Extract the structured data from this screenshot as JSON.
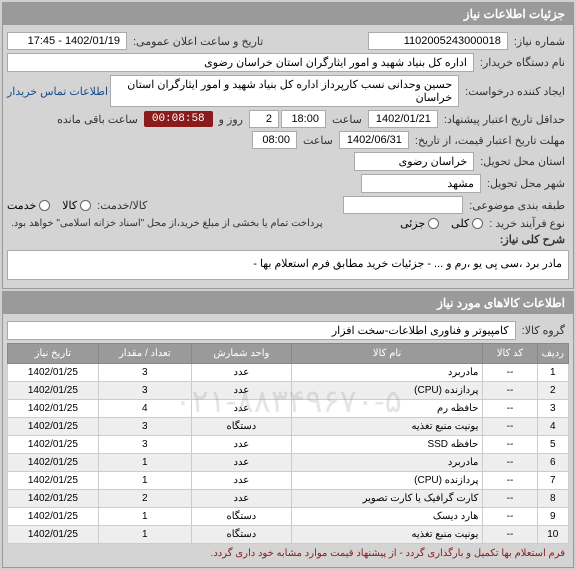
{
  "header": {
    "title": "جزئیات اطلاعات نیاز"
  },
  "fields": {
    "need_no_label": "شماره نیاز:",
    "need_no": "1102005243000018",
    "announce_label": "تاریخ و ساعت اعلان عمومی:",
    "announce": "1402/01/19 - 17:45",
    "buyer_label": "نام دستگاه خریدار:",
    "buyer": "اداره کل بنیاد شهید و امور ایثارگران استان خراسان رضوی",
    "creator_label": "ایجاد کننده درخواست:",
    "creator": "حسین وحدانی نسب کارپرداز اداره کل بنیاد شهید و امور ایثارگران استان خراسان",
    "contact_link": "اطلاعات تماس خریدار",
    "deadline_label": "حداقل تاریخ اعتبار پیشنهاد:",
    "deadline_date": "1402/01/21",
    "deadline_time_label": "ساعت",
    "deadline_time": "18:00",
    "deadline_days_label": "روز و",
    "deadline_days": "2",
    "remaining_label": "ساعت باقی مانده",
    "timer": "00:08:58",
    "validity_label": "مهلت تاریخ اعتبار قیمت، از تاریخ:",
    "validity_date": "1402/06/31",
    "validity_time": "08:00",
    "province_label": "استان محل تحویل:",
    "province": "خراسان رضوی",
    "city_label": "شهر محل تحویل:",
    "city": "مشهد",
    "class_label": "طبقه بندی موضوعی:",
    "service_label": "کالا/خدمت:",
    "opt_service": "خدمت",
    "opt_goods": "کالا",
    "buy_type_label": "نوع فرآیند خرید :",
    "opt_partial": "جزئی",
    "opt_full": "کلی",
    "pay_note": "پرداخت تمام یا بخشی از مبلغ خرید،از محل \"اسناد خزانه اسلامی\" خواهد بود.",
    "desc_label": "شرح کلی نیاز:",
    "desc": "مادر برد ،سی پی یو ،رم و ... - جزئیات خرید مطابق فرم استعلام بها -"
  },
  "section2": {
    "title": "اطلاعات کالاهای مورد نیاز",
    "group_label": "گروه کالا:",
    "group": "کامپیوتر و فناوری اطلاعات-سخت افزار"
  },
  "table": {
    "headers": {
      "row": "ردیف",
      "code": "کد کالا",
      "name": "نام کالا",
      "unit": "واحد شمارش",
      "qty": "تعداد / مقدار",
      "date": "تاریخ نیاز"
    },
    "rows": [
      {
        "r": "1",
        "code": "--",
        "name": "مادربرد",
        "unit": "عدد",
        "qty": "3",
        "date": "1402/01/25"
      },
      {
        "r": "2",
        "code": "--",
        "name": "پردازنده (CPU)",
        "unit": "عدد",
        "qty": "3",
        "date": "1402/01/25"
      },
      {
        "r": "3",
        "code": "--",
        "name": "حافظه رم",
        "unit": "عدد",
        "qty": "4",
        "date": "1402/01/25"
      },
      {
        "r": "4",
        "code": "--",
        "name": "یونیت منبع تغذیه",
        "unit": "دستگاه",
        "qty": "3",
        "date": "1402/01/25"
      },
      {
        "r": "5",
        "code": "--",
        "name": "حافظه SSD",
        "unit": "عدد",
        "qty": "3",
        "date": "1402/01/25"
      },
      {
        "r": "6",
        "code": "--",
        "name": "مادربرد",
        "unit": "عدد",
        "qty": "1",
        "date": "1402/01/25"
      },
      {
        "r": "7",
        "code": "--",
        "name": "پردازنده (CPU)",
        "unit": "عدد",
        "qty": "1",
        "date": "1402/01/25"
      },
      {
        "r": "8",
        "code": "--",
        "name": "کارت گرافیک یا کارت تصویر",
        "unit": "عدد",
        "qty": "2",
        "date": "1402/01/25"
      },
      {
        "r": "9",
        "code": "--",
        "name": "هارد دیسک",
        "unit": "دستگاه",
        "qty": "1",
        "date": "1402/01/25"
      },
      {
        "r": "10",
        "code": "--",
        "name": "یونیت منبع تغذیه",
        "unit": "دستگاه",
        "qty": "1",
        "date": "1402/01/25"
      }
    ]
  },
  "footer": {
    "note": "فرم استعلام بها تکمیل و بارگذاری گردد - از پیشنهاد قیمت موارد مشابه خود داری گردد."
  },
  "watermark": "۰۲۱-۸۸۳۴۹۶۷۰-۵"
}
